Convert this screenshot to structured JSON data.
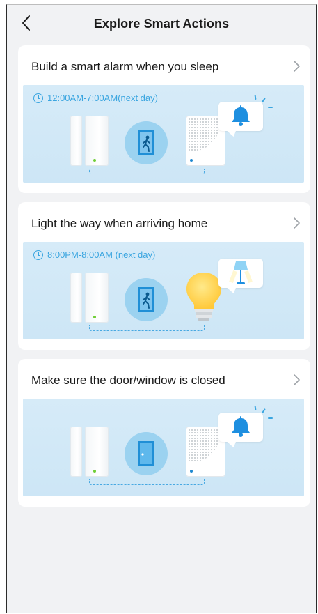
{
  "header": {
    "title": "Explore Smart Actions",
    "back_icon": "chevron-left-icon"
  },
  "cards": [
    {
      "title": "Build a smart alarm when you sleep",
      "time": "12:00AM-7:00AM(next day)",
      "devices": [
        "contact-sensor",
        "door-open-motion",
        "hub-speaker"
      ],
      "notification_icon": "bell-icon"
    },
    {
      "title": "Light the way when arriving home",
      "time": "8:00PM-8:00AM (next day)",
      "devices": [
        "contact-sensor",
        "door-open-motion",
        "smart-bulb"
      ],
      "notification_icon": "floor-lamp-icon"
    },
    {
      "title": "Make sure the door/window is closed",
      "devices": [
        "contact-sensor",
        "door-closed",
        "hub-speaker"
      ],
      "notification_icon": "bell-icon"
    }
  ],
  "colors": {
    "accent": "#3aa5e0",
    "scene_bg": "#d2e9f7",
    "page_bg": "#f1f2f4",
    "card_bg": "#ffffff",
    "bulb_yellow": "#ffd84a",
    "led_green": "#6fce35"
  }
}
